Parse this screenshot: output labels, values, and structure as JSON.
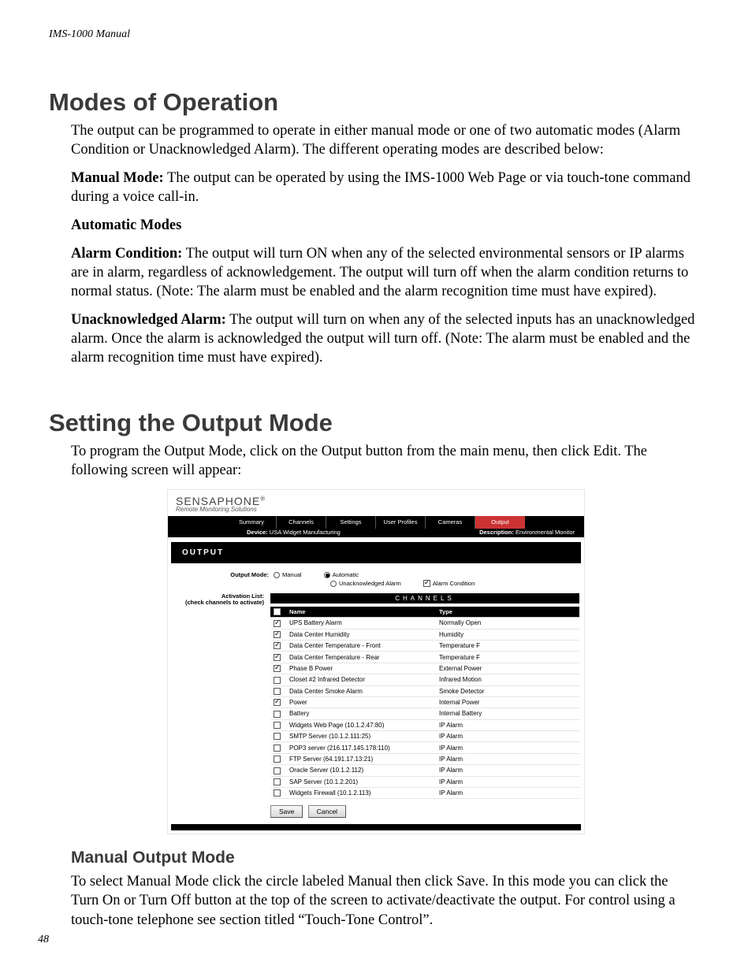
{
  "header": {
    "running": "IMS-1000  Manual",
    "page_number": "48"
  },
  "s1": {
    "title": "Modes of Operation",
    "p1": "The output can be programmed to operate in either manual mode or one of two automatic modes (Alarm Condition or Unacknowledged Alarm). The different operating modes are described below:",
    "manual_label": "Manual Mode:",
    "manual_text": " The output can be operated by using the IMS-1000 Web Page or via touch-tone command during a voice call-in.",
    "auto_h": "Automatic Modes",
    "alarm_label": "Alarm Condition:",
    "alarm_text": " The output will turn ON when any of the selected environmental sensors or IP alarms are in alarm, regardless of acknowledgement. The output will turn off when the alarm condition returns to normal status. (Note: The alarm must be enabled and the alarm recognition time must have expired).",
    "unack_label": "Unacknowledged Alarm:",
    "unack_text": " The output will turn on when any of the selected inputs has an unacknowledged alarm. Once the alarm is acknowledged the output will turn off. (Note: The alarm must be enabled and the alarm recognition time must have expired)."
  },
  "s2": {
    "title": "Setting the Output Mode",
    "p1": "To program the Output Mode, click on the Output button from the main menu, then click Edit. The following screen will appear:"
  },
  "shot": {
    "brand": "SENSAPHONE",
    "brand_reg": "®",
    "brand_sub": "Remote Monitoring Solutions",
    "nav": [
      "Summary",
      "Channels",
      "Settings",
      "User Profiles",
      "Cameras",
      "Output"
    ],
    "nav_active": 5,
    "device_label": "Device:",
    "device_value": "USA Widget Manufacturing",
    "desc_label": "Description:",
    "desc_value": "Environmental Monitor",
    "section": "OUTPUT",
    "mode_label": "Output Mode:",
    "mode_manual": "Manual",
    "mode_auto": "Automatic",
    "mode_unack": "Unacknowledged Alarm",
    "mode_ac": "Alarm Condition",
    "mode_state": {
      "manual": false,
      "automatic": true,
      "auto_sub": "alarm_condition"
    },
    "act_label_1": "Activation List:",
    "act_label_2": "(check channels to activate)",
    "channels_bar": "CHANNELS",
    "col_name": "Name",
    "col_type": "Type",
    "rows": [
      {
        "c": true,
        "n": "UPS Battery Alarm",
        "t": "Normally Open"
      },
      {
        "c": true,
        "n": "Data Center Humidity",
        "t": "Humidity"
      },
      {
        "c": true,
        "n": "Data Center Temperature - Front",
        "t": "Temperature F"
      },
      {
        "c": true,
        "n": "Data Center Temperature - Rear",
        "t": "Temperature F"
      },
      {
        "c": true,
        "n": "Phase B Power",
        "t": "External Power"
      },
      {
        "c": false,
        "n": "Closet #2 Infrared Detector",
        "t": "Infrared Motion"
      },
      {
        "c": false,
        "n": "Data Center Smoke Alarm",
        "t": "Smoke Detector"
      },
      {
        "c": true,
        "n": "Power",
        "t": "Internal Power"
      },
      {
        "c": false,
        "n": "Battery",
        "t": "Internal Battery"
      },
      {
        "c": false,
        "n": "Widgets Web Page (10.1.2.47:80)",
        "t": "IP Alarm"
      },
      {
        "c": false,
        "n": "SMTP Server (10.1.2.111:25)",
        "t": "IP Alarm"
      },
      {
        "c": false,
        "n": "POP3 server (216.117.145.178:110)",
        "t": "IP Alarm"
      },
      {
        "c": false,
        "n": "FTP Server (64.191.17.13:21)",
        "t": "IP Alarm"
      },
      {
        "c": false,
        "n": "Oracle Server (10.1.2.112)",
        "t": "IP Alarm"
      },
      {
        "c": false,
        "n": "SAP Server (10.1.2.201)",
        "t": "IP Alarm"
      },
      {
        "c": false,
        "n": "Widgets Firewall (10.1.2.113)",
        "t": "IP Alarm"
      }
    ],
    "save": "Save",
    "cancel": "Cancel"
  },
  "s3": {
    "title": "Manual Output Mode",
    "p1": "To select Manual Mode click the circle labeled Manual then click Save. In this mode you can click the Turn On or Turn Off button at the top of the screen to activate/deactivate the output. For control using a touch-tone telephone see section titled “Touch-Tone Control”."
  }
}
